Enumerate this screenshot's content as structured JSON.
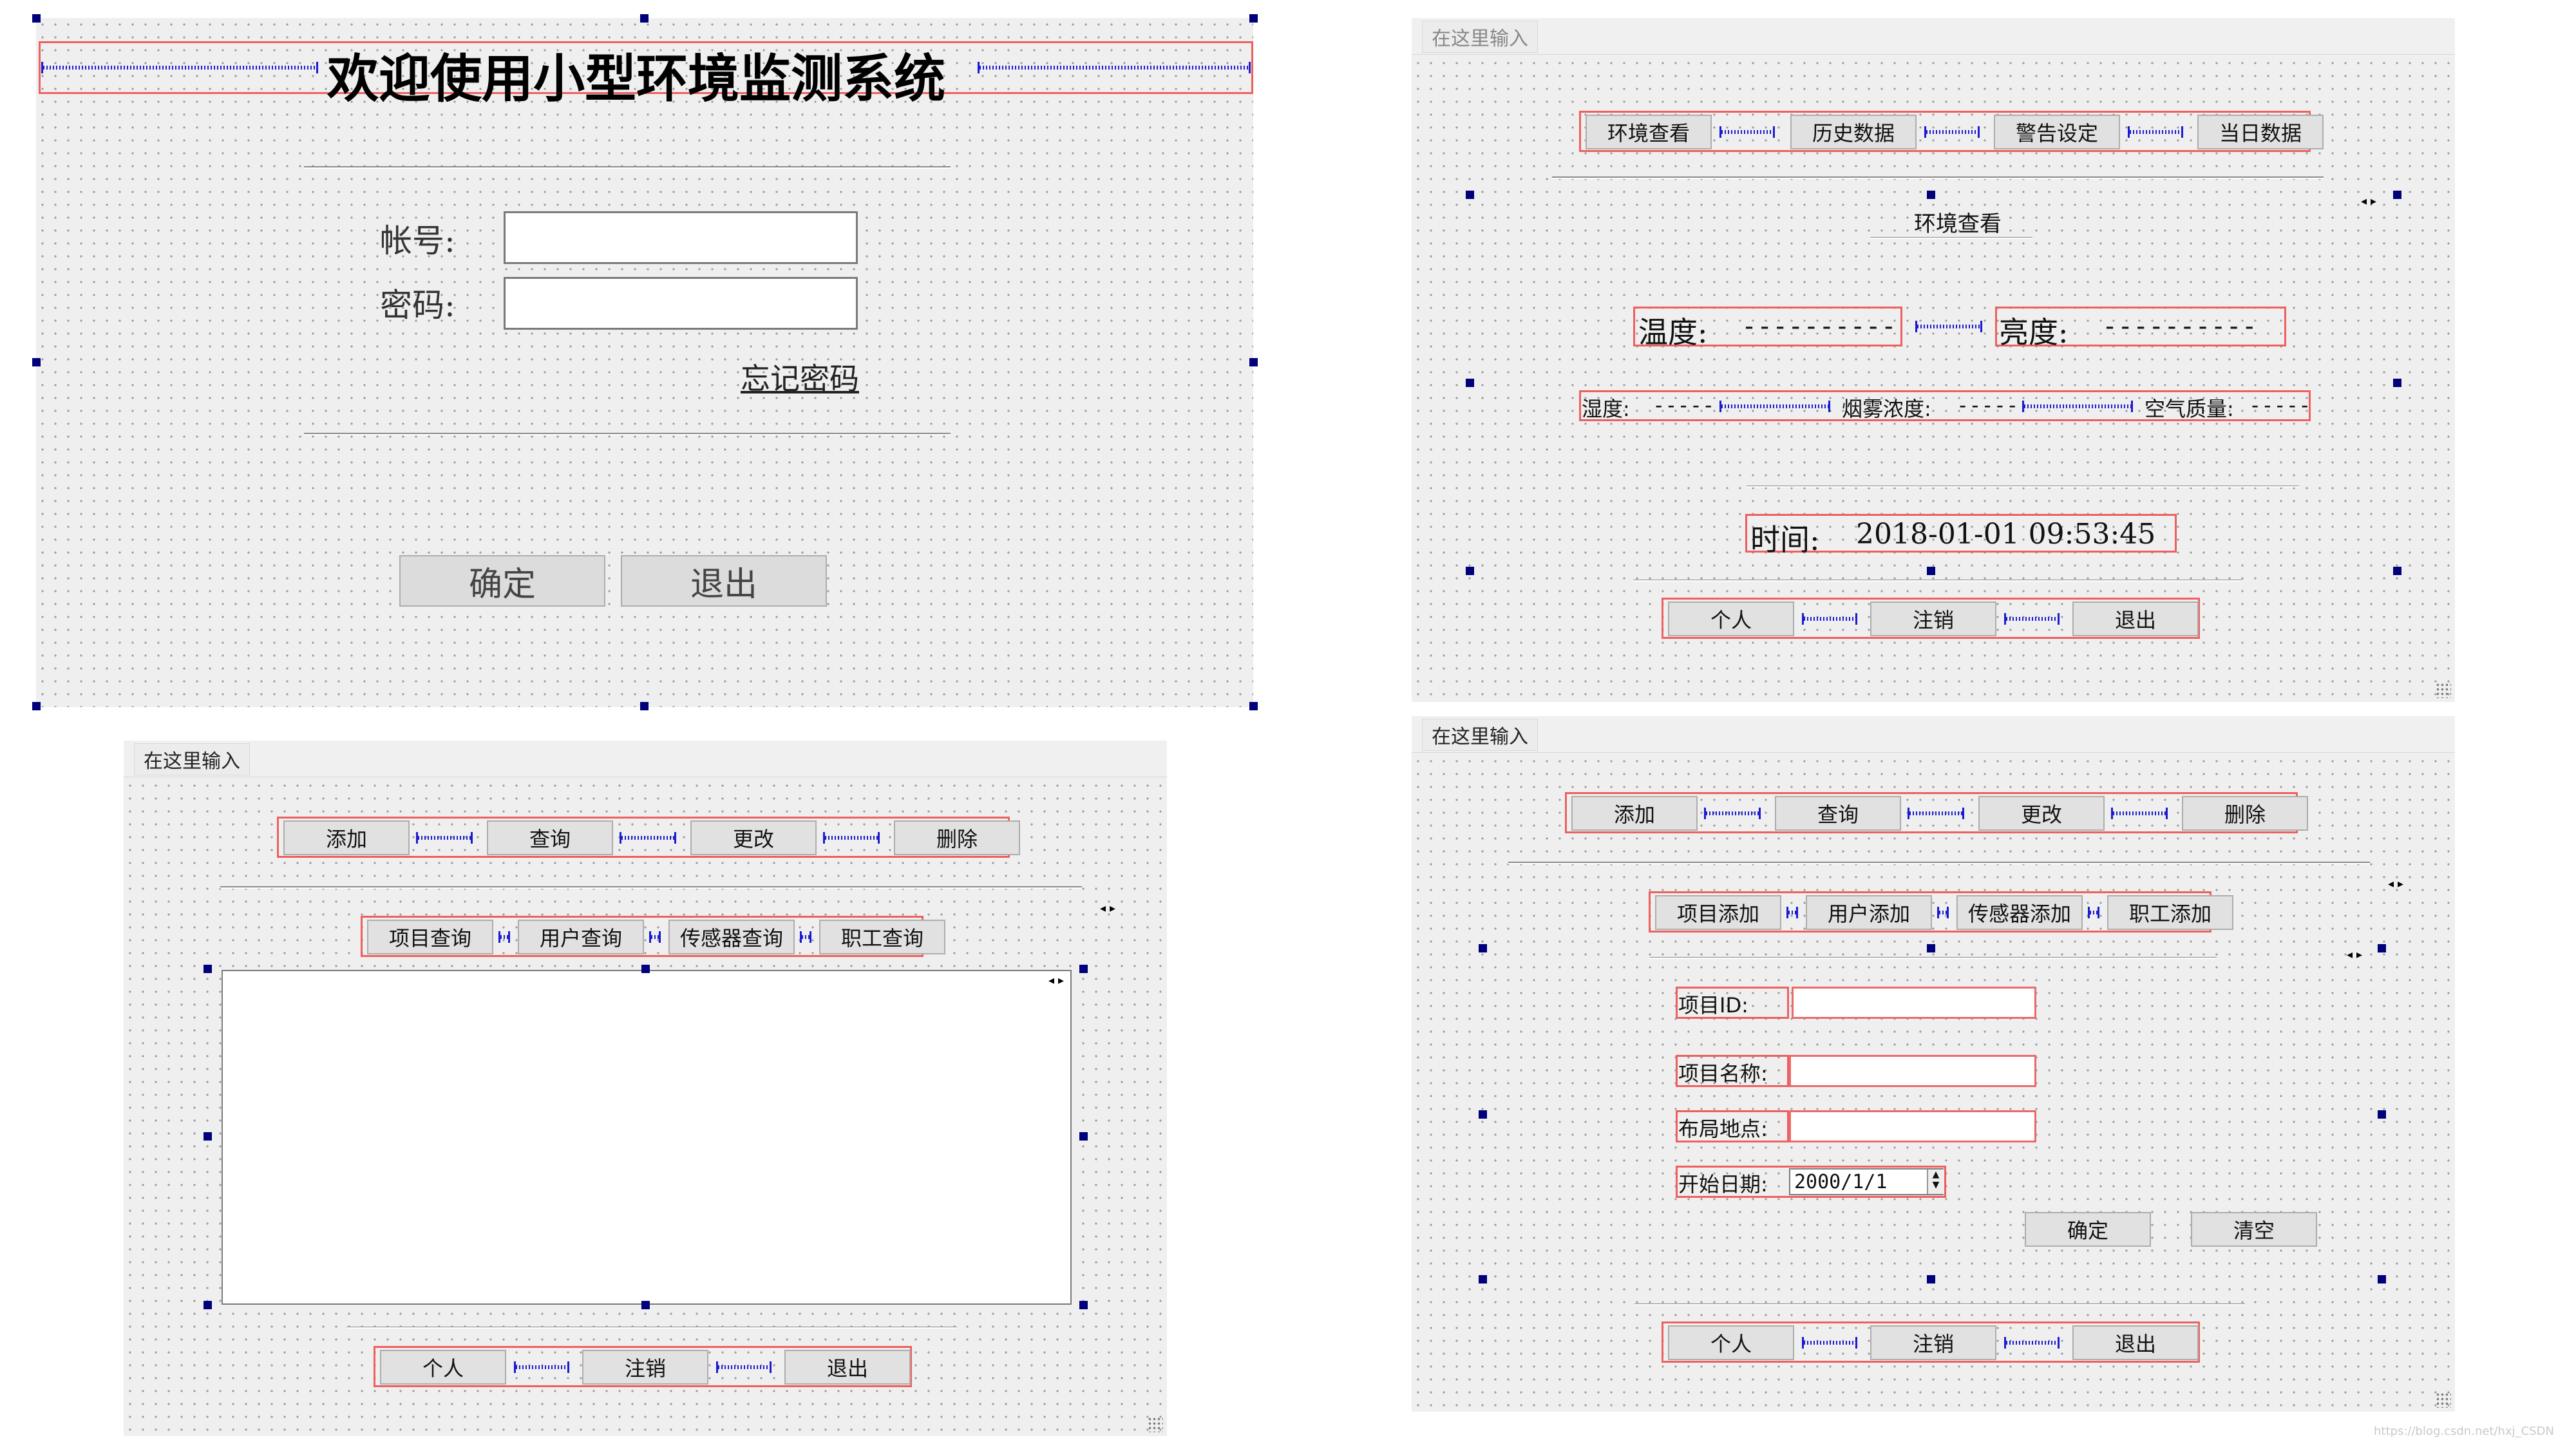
{
  "login": {
    "title": "欢迎使用小型环境监测系统",
    "account_label": "帐号:",
    "password_label": "密码:",
    "account_value": "",
    "password_value": "",
    "forgot_link": "忘记密码",
    "confirm": "确定",
    "exit": "退出"
  },
  "monitor": {
    "menu_placeholder": "在这里输入",
    "tabs": [
      "环境查看",
      "历史数据",
      "警告设定",
      "当日数据"
    ],
    "section_title": "环境查看",
    "temperature_label": "温度:",
    "temperature_value": "----------",
    "brightness_label": "亮度:",
    "brightness_value": "----------",
    "humidity_label": "湿度:",
    "humidity_value": "-----",
    "smoke_label": "烟雾浓度:",
    "smoke_value": "-----",
    "air_label": "空气质量:",
    "air_value": "-----",
    "time_label": "时间:",
    "time_value": "2018-01-01 09:53:45",
    "bottom_buttons": [
      "个人",
      "注销",
      "退出"
    ]
  },
  "query": {
    "menu_placeholder": "在这里输入",
    "actions": [
      "添加",
      "查询",
      "更改",
      "删除"
    ],
    "subtabs": [
      "项目查询",
      "用户查询",
      "传感器查询",
      "职工查询"
    ],
    "bottom_buttons": [
      "个人",
      "注销",
      "退出"
    ]
  },
  "add": {
    "menu_placeholder": "在这里输入",
    "actions": [
      "添加",
      "查询",
      "更改",
      "删除"
    ],
    "subtabs": [
      "项目添加",
      "用户添加",
      "传感器添加",
      "职工添加"
    ],
    "project_id_label": "项目ID:",
    "project_name_label": "项目名称:",
    "location_label": "布局地点:",
    "start_date_label": "开始日期:",
    "start_date_value": "2000/1/1",
    "confirm": "确定",
    "clear": "清空",
    "bottom_buttons": [
      "个人",
      "注销",
      "退出"
    ]
  },
  "watermark": "https://blog.csdn.net/hxj_CSDN"
}
